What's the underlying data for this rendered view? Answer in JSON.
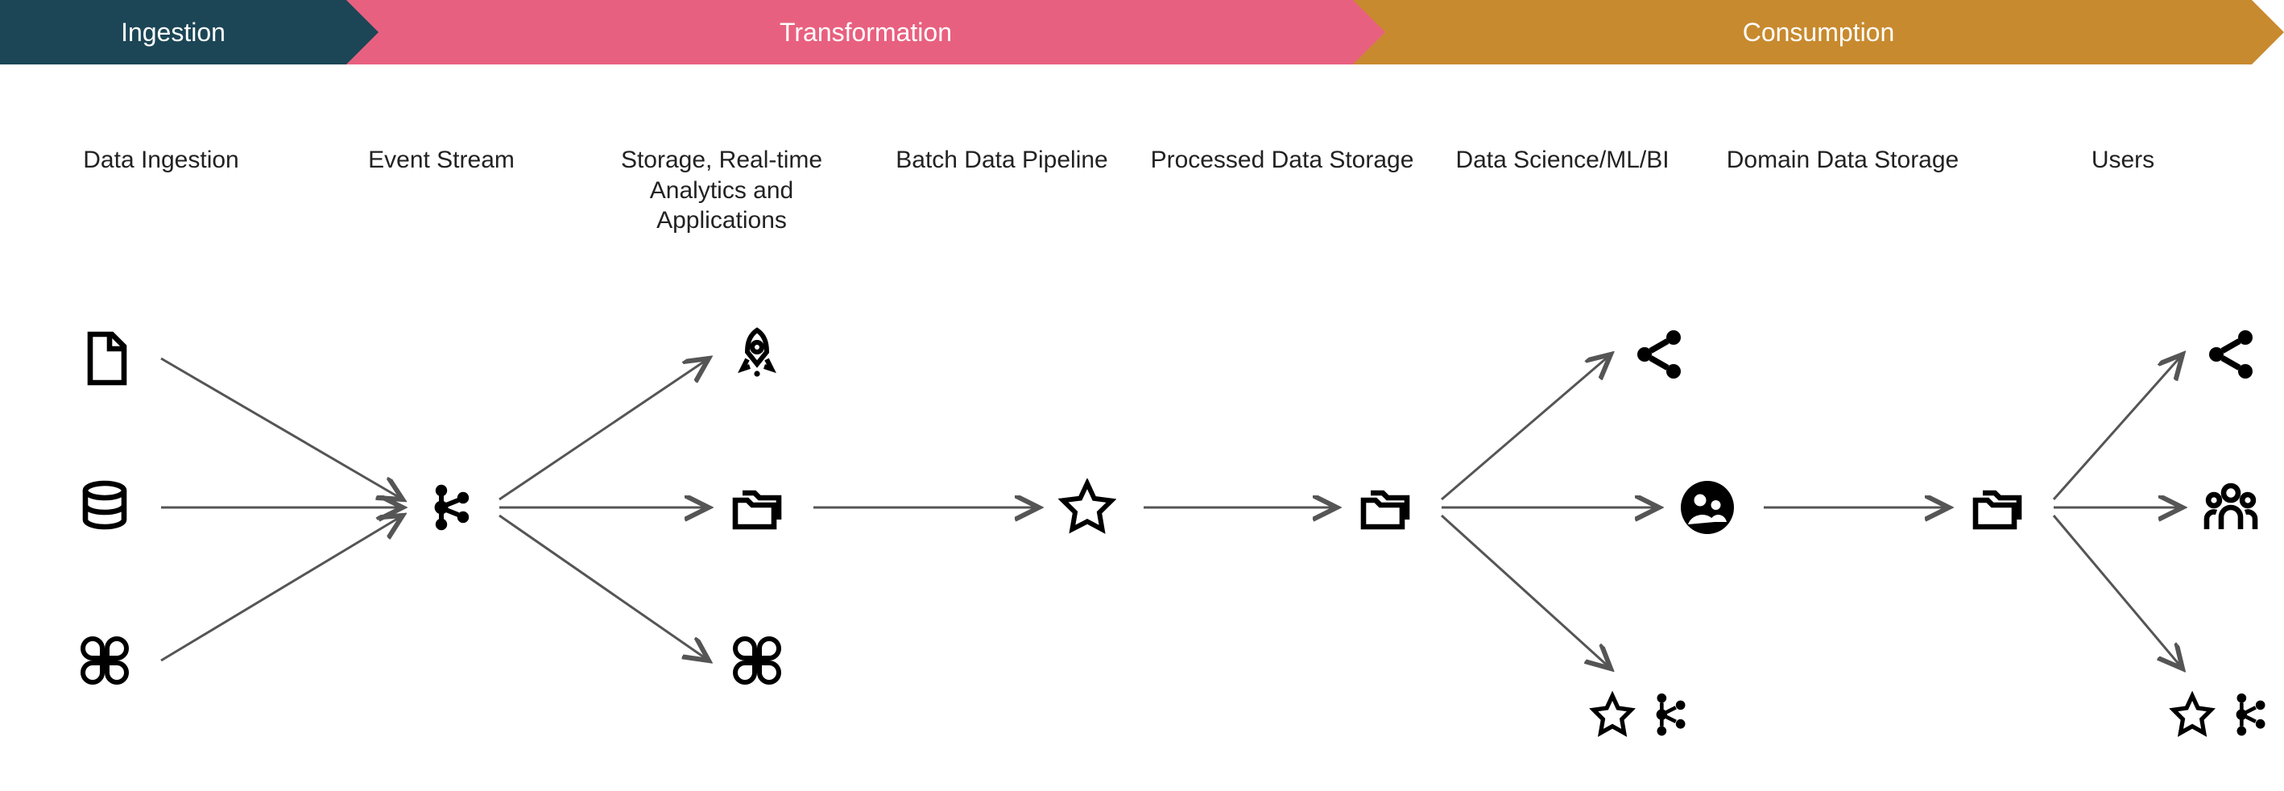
{
  "stages": {
    "stage1": "Ingestion",
    "stage2": "Transformation",
    "stage3": "Consumption"
  },
  "columns": {
    "c1": "Data Ingestion",
    "c2": "Event Stream",
    "c3": "Storage, Real-time Analytics and Applications",
    "c4": "Batch Data Pipeline",
    "c5": "Processed Data Storage",
    "c6": "Data Science/ML/BI",
    "c7": "Domain Data Storage",
    "c8": "Users"
  },
  "colors": {
    "ingestion": "#1c4656",
    "transformation": "#e8607f",
    "consumption": "#c88a2e"
  },
  "icons": {
    "file": "file-icon",
    "database": "database-icon",
    "apps": "apps-icon",
    "kafka": "kafka-icon",
    "rocket": "rocket-icon",
    "folders": "folders-icon",
    "star": "star-icon",
    "share": "share-icon",
    "people_circle": "people-circle-icon",
    "users": "users-icon"
  }
}
